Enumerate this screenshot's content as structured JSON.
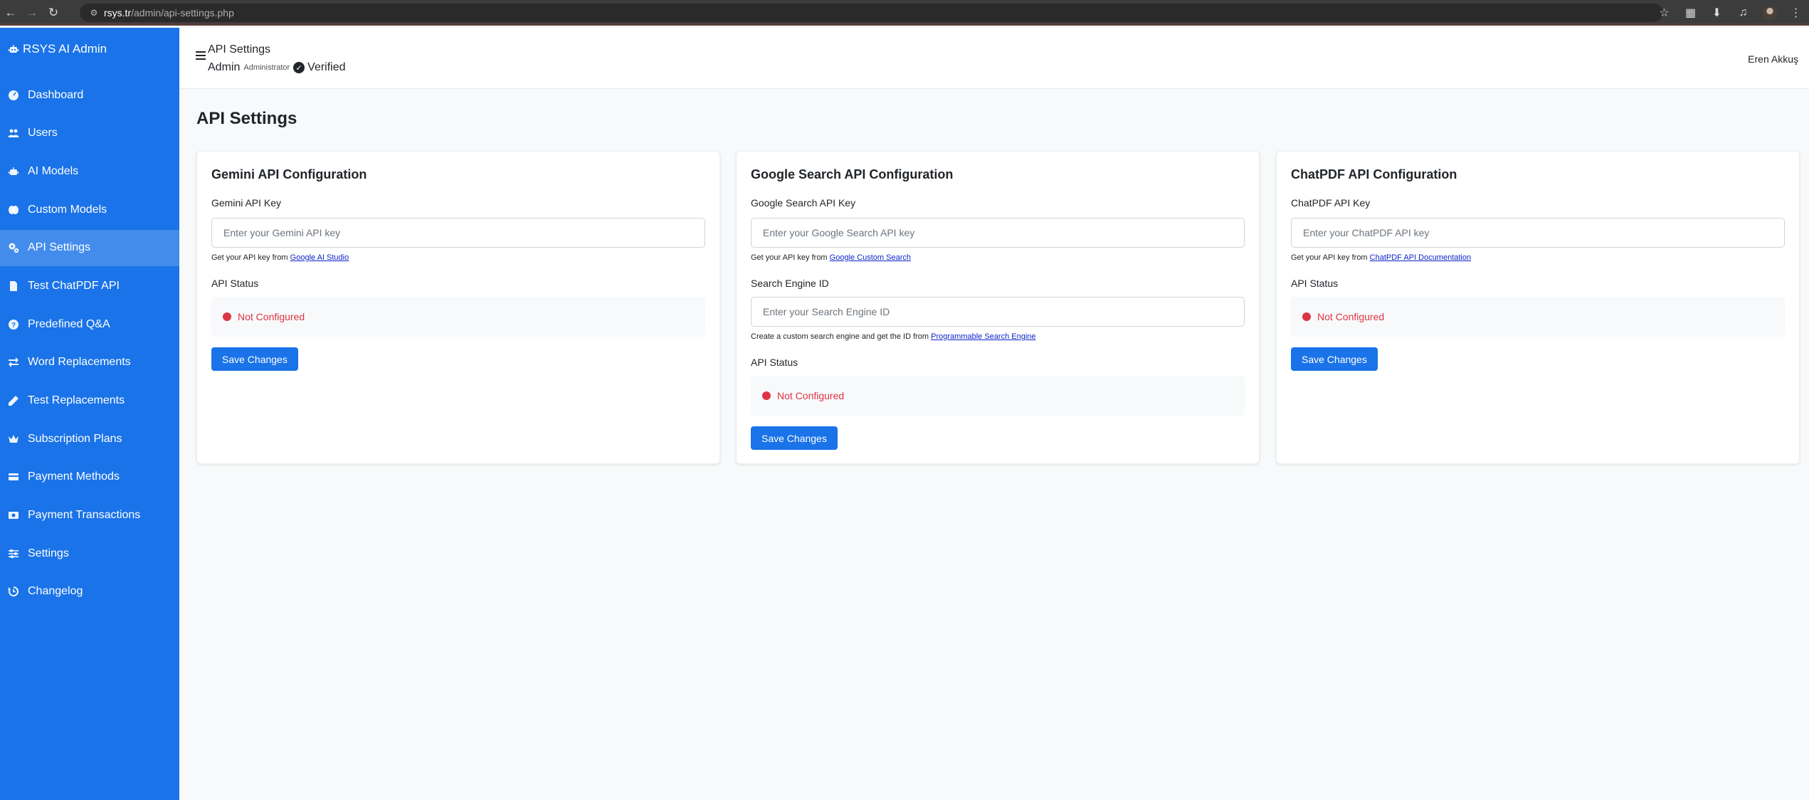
{
  "browser": {
    "url_host": "rsys.tr",
    "url_path": "/admin/api-settings.php"
  },
  "colors": {
    "brand": "#1a73e8",
    "status_error": "#dc3545",
    "link": "#0d24c9"
  },
  "sidebar": {
    "brand": "RSYS AI Admin",
    "items": [
      {
        "label": "Dashboard",
        "icon": "gauge-icon"
      },
      {
        "label": "Users",
        "icon": "users-icon"
      },
      {
        "label": "AI Models",
        "icon": "robot-icon"
      },
      {
        "label": "Custom Models",
        "icon": "brain-icon"
      },
      {
        "label": "API Settings",
        "icon": "gears-icon",
        "active": true
      },
      {
        "label": "Test ChatPDF API",
        "icon": "file-pdf-icon"
      },
      {
        "label": "Predefined Q&A",
        "icon": "question-circle-icon"
      },
      {
        "label": "Word Replacements",
        "icon": "exchange-icon"
      },
      {
        "label": "Test Replacements",
        "icon": "pencil-icon"
      },
      {
        "label": "Subscription Plans",
        "icon": "crown-icon"
      },
      {
        "label": "Payment Methods",
        "icon": "credit-card-icon"
      },
      {
        "label": "Payment Transactions",
        "icon": "money-bill-icon"
      },
      {
        "label": "Settings",
        "icon": "sliders-icon"
      },
      {
        "label": "Changelog",
        "icon": "history-icon"
      }
    ]
  },
  "header": {
    "title": "API Settings",
    "user_name": "Admin",
    "user_role": "Administrator",
    "verified": "Verified",
    "right_user": "Eren Akkuş"
  },
  "main": {
    "page_title": "API Settings",
    "gemini": {
      "title": "Gemini API Configuration",
      "key_label": "Gemini API Key",
      "key_placeholder": "Enter your Gemini API key",
      "key_value": "",
      "hint_prefix": "Get your API key from",
      "hint_link": "Google AI Studio",
      "status_label": "API Status",
      "status_text": "Not Configured",
      "save": "Save Changes"
    },
    "google": {
      "title": "Google Search API Configuration",
      "key_label": "Google Search API Key",
      "key_placeholder": "Enter your Google Search API key",
      "key_value": "",
      "hint_prefix": "Get your API key from",
      "hint_link": "Google Custom Search",
      "engine_label": "Search Engine ID",
      "engine_placeholder": "Enter your Search Engine ID",
      "engine_value": "",
      "engine_hint_prefix": "Create a custom search engine and get the ID from",
      "engine_hint_link": "Programmable Search Engine",
      "status_label": "API Status",
      "status_text": "Not Configured",
      "save": "Save Changes"
    },
    "chatpdf": {
      "title": "ChatPDF API Configuration",
      "key_label": "ChatPDF API Key",
      "key_placeholder": "Enter your ChatPDF API key",
      "key_value": "",
      "hint_prefix": "Get your API key from",
      "hint_link": "ChatPDF API Documentation",
      "status_label": "API Status",
      "status_text": "Not Configured",
      "save": "Save Changes"
    }
  }
}
